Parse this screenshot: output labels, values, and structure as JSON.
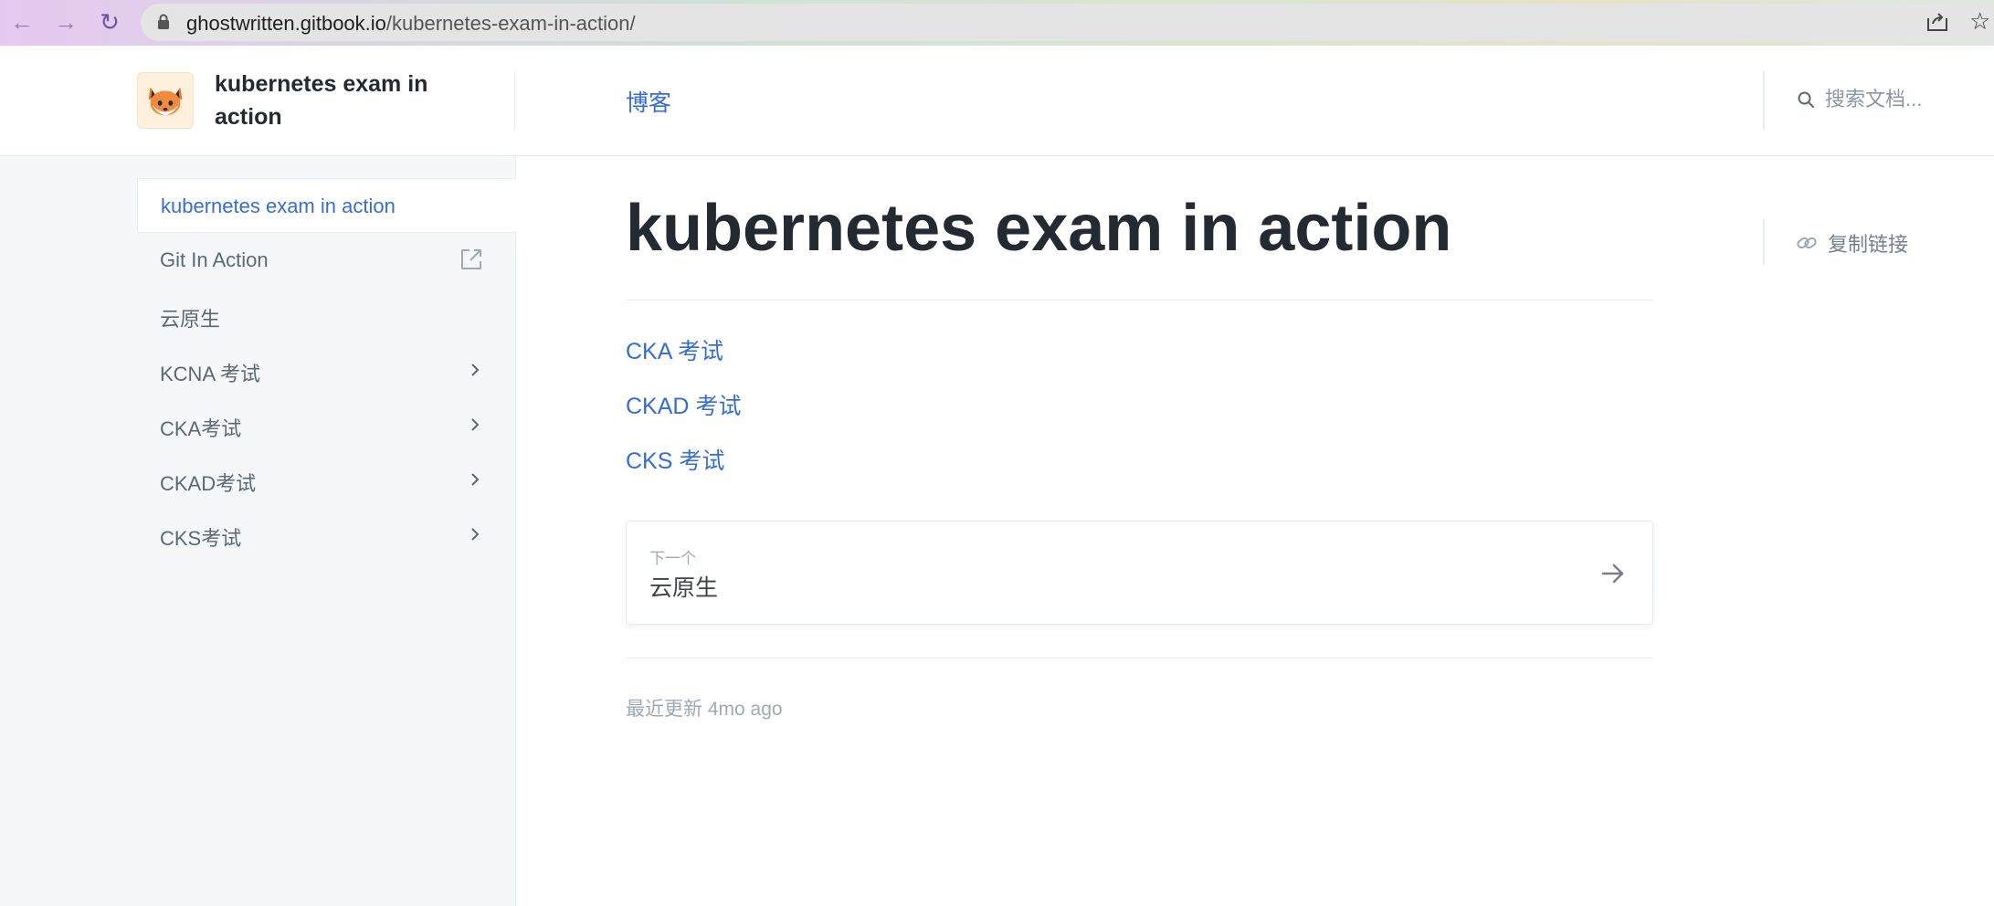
{
  "browser": {
    "url_host": "ghostwritten.gitbook.io",
    "url_path": "/kubernetes-exam-in-action/",
    "icons": [
      "back-arrow-icon",
      "forward-arrow-icon",
      "reload-icon",
      "lock-icon",
      "share-icon",
      "star-icon"
    ]
  },
  "header": {
    "site_title": "kubernetes exam in action",
    "nav_link": "博客",
    "search_placeholder": "搜索文档..."
  },
  "sidebar": {
    "items": [
      {
        "label": "kubernetes exam in action",
        "active": true,
        "icon": null
      },
      {
        "label": "Git In Action",
        "active": false,
        "icon": "external-link-icon"
      },
      {
        "label": "云原生",
        "active": false,
        "icon": null
      },
      {
        "label": "KCNA 考试",
        "active": false,
        "icon": "chevron-right-icon"
      },
      {
        "label": "CKA考试",
        "active": false,
        "icon": "chevron-right-icon"
      },
      {
        "label": "CKAD考试",
        "active": false,
        "icon": "chevron-right-icon"
      },
      {
        "label": "CKS考试",
        "active": false,
        "icon": "chevron-right-icon"
      }
    ]
  },
  "main": {
    "title": "kubernetes exam in action",
    "copy_link": "复制链接",
    "links": [
      "CKA 考试",
      "CKAD 考试",
      "CKS 考试"
    ],
    "next": {
      "caption": "下一个",
      "title": "云原生"
    },
    "last_updated": "最近更新 4mo ago"
  },
  "colors": {
    "accent": "#346ddb",
    "title": "#242a31",
    "muted": "#9daab6",
    "sidebar_bg": "#f5f7f9",
    "border": "#e6ecf1"
  }
}
